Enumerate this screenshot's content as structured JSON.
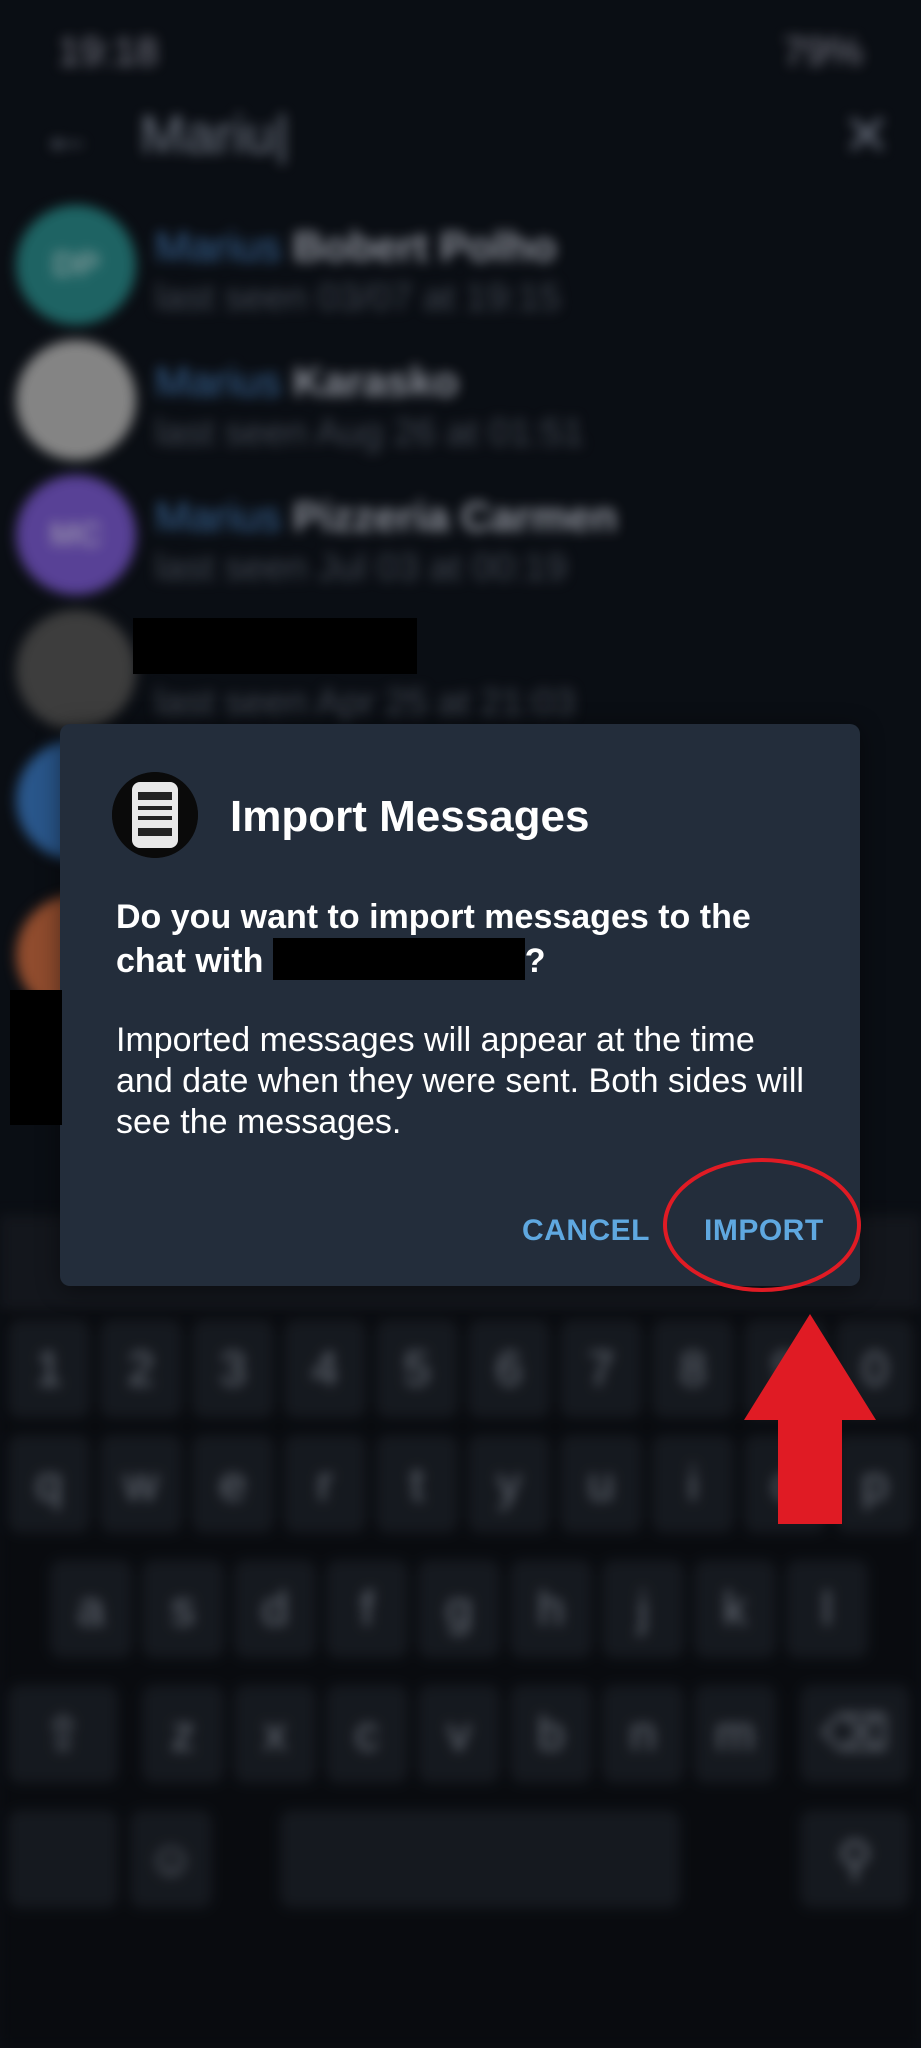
{
  "status_bar": {
    "time": "19:18",
    "battery": "79%"
  },
  "search": {
    "query": "Mariu|"
  },
  "contacts": [
    {
      "initials": "DP",
      "highlight": "Marius",
      "name": "Bobert Polho",
      "seen": "last seen 03/07 at 19:15",
      "color": "#2a8a8a"
    },
    {
      "initials": "",
      "highlight": "Marius",
      "name": "Karasko",
      "seen": "last seen Aug 26 at 01:51",
      "color": "#b8b8b8"
    },
    {
      "initials": "MC",
      "highlight": "Marius",
      "name": "Pizzeria Carmen",
      "seen": "last seen Jul 03 at 00:19",
      "color": "#7a5ad0"
    },
    {
      "initials": "",
      "highlight": "",
      "name": "",
      "seen": "last seen Apr 25 at 21:03",
      "color": "#555555"
    }
  ],
  "keyboard": {
    "numbers": [
      "1",
      "2",
      "3",
      "4",
      "5",
      "6",
      "7",
      "8",
      "9",
      "0"
    ],
    "row1": [
      "q",
      "w",
      "e",
      "r",
      "t",
      "y",
      "u",
      "i",
      "o",
      "p"
    ],
    "row2": [
      "a",
      "s",
      "d",
      "f",
      "g",
      "h",
      "j",
      "k",
      "l"
    ],
    "row3": [
      "z",
      "x",
      "c",
      "v",
      "b",
      "n",
      "m"
    ]
  },
  "dialog": {
    "title": "Import Messages",
    "question_prefix": "Do you want to import messages to the chat with",
    "question_suffix": "?",
    "body": "Imported messages will appear at the time and date when they were sent. Both sides will see the messages.",
    "cancel_label": "CANCEL",
    "import_label": "IMPORT"
  },
  "colors": {
    "accent": "#5fa8e0",
    "dialog_bg": "#232d3b",
    "annotation_red": "#e01b24"
  }
}
